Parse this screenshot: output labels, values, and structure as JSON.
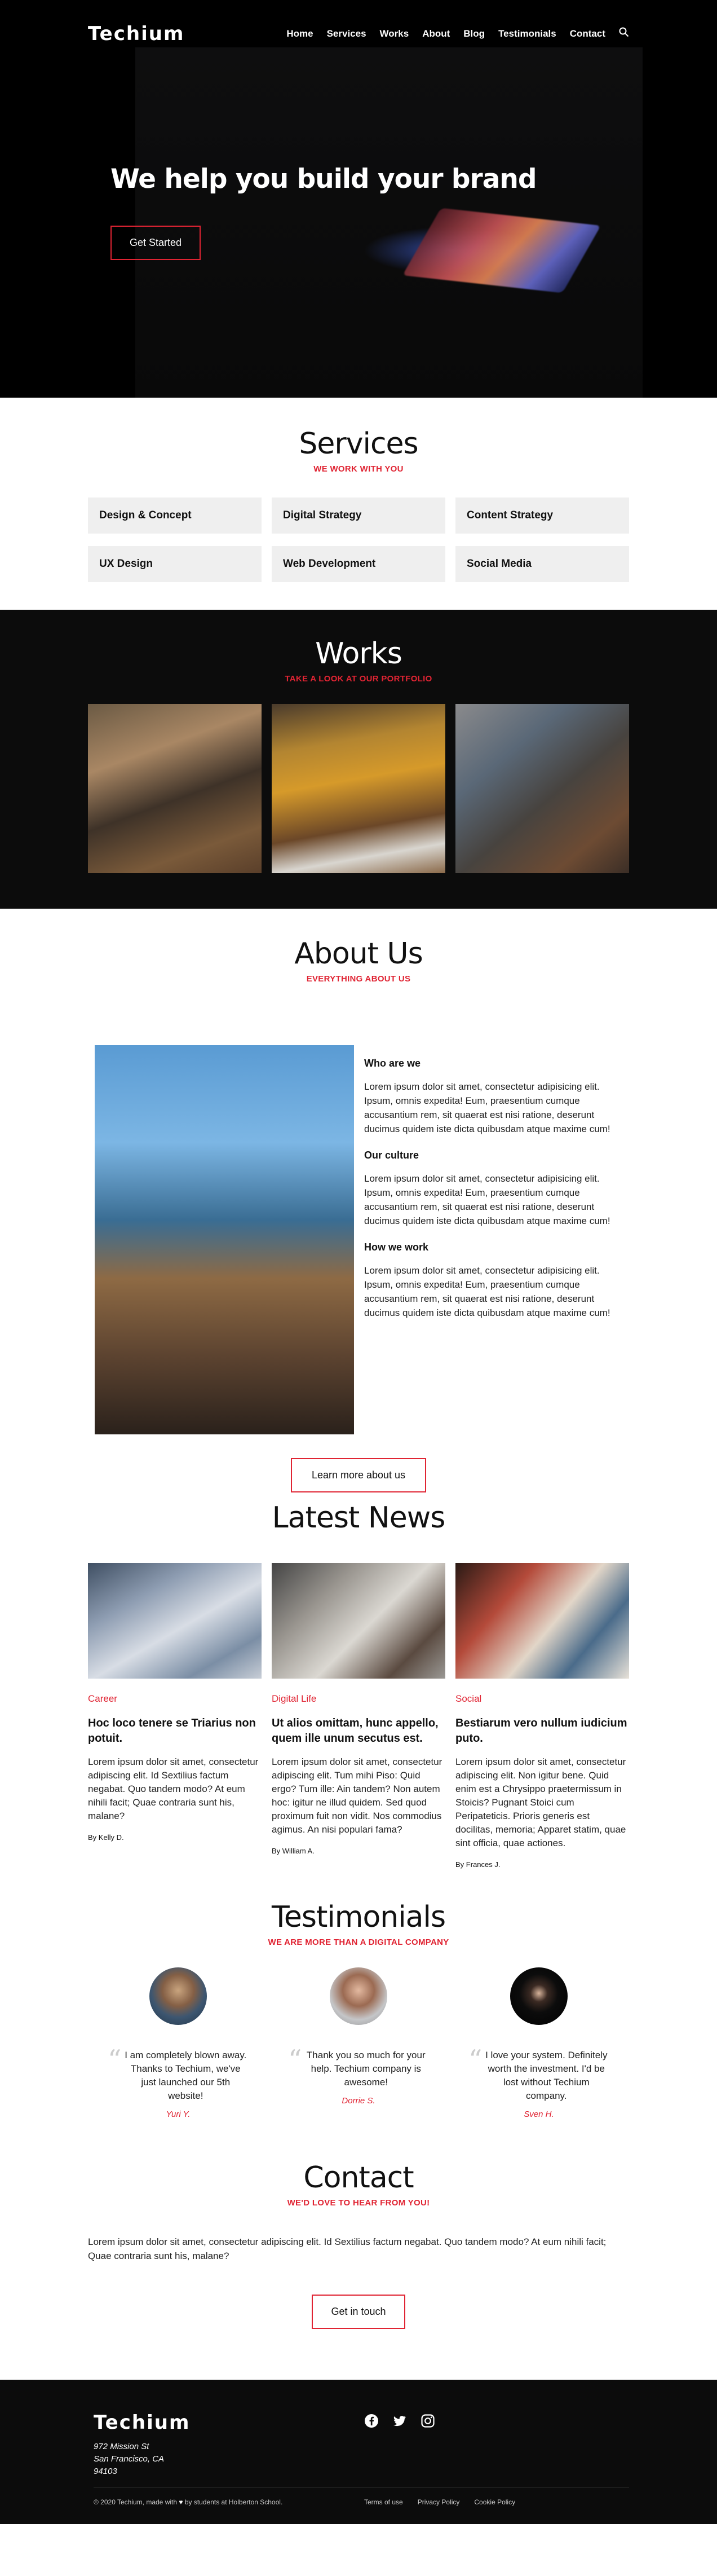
{
  "brand": "Techium",
  "nav": {
    "items": [
      "Home",
      "Services",
      "Works",
      "About",
      "Blog",
      "Testimonials",
      "Contact"
    ],
    "search_icon": "search-icon"
  },
  "hero": {
    "headline": "We help you build your brand",
    "cta": "Get Started"
  },
  "services": {
    "title": "Services",
    "subtitle": "WE WORK WITH YOU",
    "items": [
      "Design & Concept",
      "Digital Strategy",
      "Content Strategy",
      "UX Design",
      "Web Development",
      "Social Media"
    ]
  },
  "works": {
    "title": "Works",
    "subtitle": "TAKE A LOOK AT OUR PORTFOLIO"
  },
  "about": {
    "title": "About Us",
    "subtitle": "EVERYTHING ABOUT US",
    "blocks": [
      {
        "heading": "Who are we",
        "text": "Lorem ipsum dolor sit amet, consectetur adipisicing elit. Ipsum, omnis expedita! Eum, praesentium cumque accusantium rem, sit quaerat est nisi ratione, deserunt ducimus quidem iste dicta quibusdam atque maxime cum!"
      },
      {
        "heading": "Our culture",
        "text": "Lorem ipsum dolor sit amet, consectetur adipisicing elit. Ipsum, omnis expedita! Eum, praesentium cumque accusantium rem, sit quaerat est nisi ratione, deserunt ducimus quidem iste dicta quibusdam atque maxime cum!"
      },
      {
        "heading": "How we work",
        "text": "Lorem ipsum dolor sit amet, consectetur adipisicing elit. Ipsum, omnis expedita! Eum, praesentium cumque accusantium rem, sit quaerat est nisi ratione, deserunt ducimus quidem iste dicta quibusdam atque maxime cum!"
      }
    ],
    "button": "Learn more about us"
  },
  "news": {
    "title": "Latest News",
    "articles": [
      {
        "category": "Career",
        "title": "Hoc loco tenere se Triarius non potuit.",
        "body": "Lorem ipsum dolor sit amet, consectetur adipiscing elit. Id Sextilius factum negabat. Quo tandem modo? At eum nihili facit; Quae contraria sunt his, malane?",
        "author": "By Kelly D."
      },
      {
        "category": "Digital Life",
        "title": "Ut alios omittam, hunc appello, quem ille unum secutus est.",
        "body": "Lorem ipsum dolor sit amet, consectetur adipiscing elit. Tum mihi Piso: Quid ergo? Tum ille: Ain tandem? Non autem hoc: igitur ne illud quidem. Sed quod proximum fuit non vidit. Nos commodius agimus. An nisi populari fama?",
        "author": "By William A."
      },
      {
        "category": "Social",
        "title": "Bestiarum vero nullum iudicium puto.",
        "body": "Lorem ipsum dolor sit amet, consectetur adipiscing elit. Non igitur bene. Quid enim est a Chrysippo praetermissum in Stoicis? Pugnant Stoici cum Peripateticis. Prioris generis est docilitas, memoria; Apparet statim, quae sint officia, quae actiones.",
        "author": "By Frances J."
      }
    ]
  },
  "testimonials": {
    "title": "Testimonials",
    "subtitle": "WE ARE MORE THAN A DIGITAL COMPANY",
    "items": [
      {
        "quote": "I am completely blown away. Thanks to Techium, we've just launched our 5th website!",
        "name": "Yuri Y."
      },
      {
        "quote": "Thank you so much for your help. Techium company is awesome!",
        "name": "Dorrie S."
      },
      {
        "quote": "I love your system. Definitely worth the investment. I'd be lost without Techium company.",
        "name": "Sven H."
      }
    ]
  },
  "contact": {
    "title": "Contact",
    "subtitle": "WE'D LOVE TO HEAR FROM YOU!",
    "text": "Lorem ipsum dolor sit amet, consectetur adipiscing elit. Id Sextilius factum negabat. Quo tandem modo? At eum nihili facit; Quae contraria sunt his, malane?",
    "button": "Get in touch"
  },
  "footer": {
    "brand": "Techium",
    "address": [
      "972 Mission St",
      "San Francisco, CA",
      "94103"
    ],
    "social": [
      "facebook-icon",
      "twitter-icon",
      "instagram-icon"
    ],
    "copyright_pre": "© 2020 Techium, made with",
    "copyright_post": "by students at Holberton School.",
    "links": [
      "Terms of use",
      "Privacy Policy",
      "Cookie Policy"
    ]
  },
  "colors": {
    "accent": "#e02433",
    "dark": "#0c0c0c"
  }
}
